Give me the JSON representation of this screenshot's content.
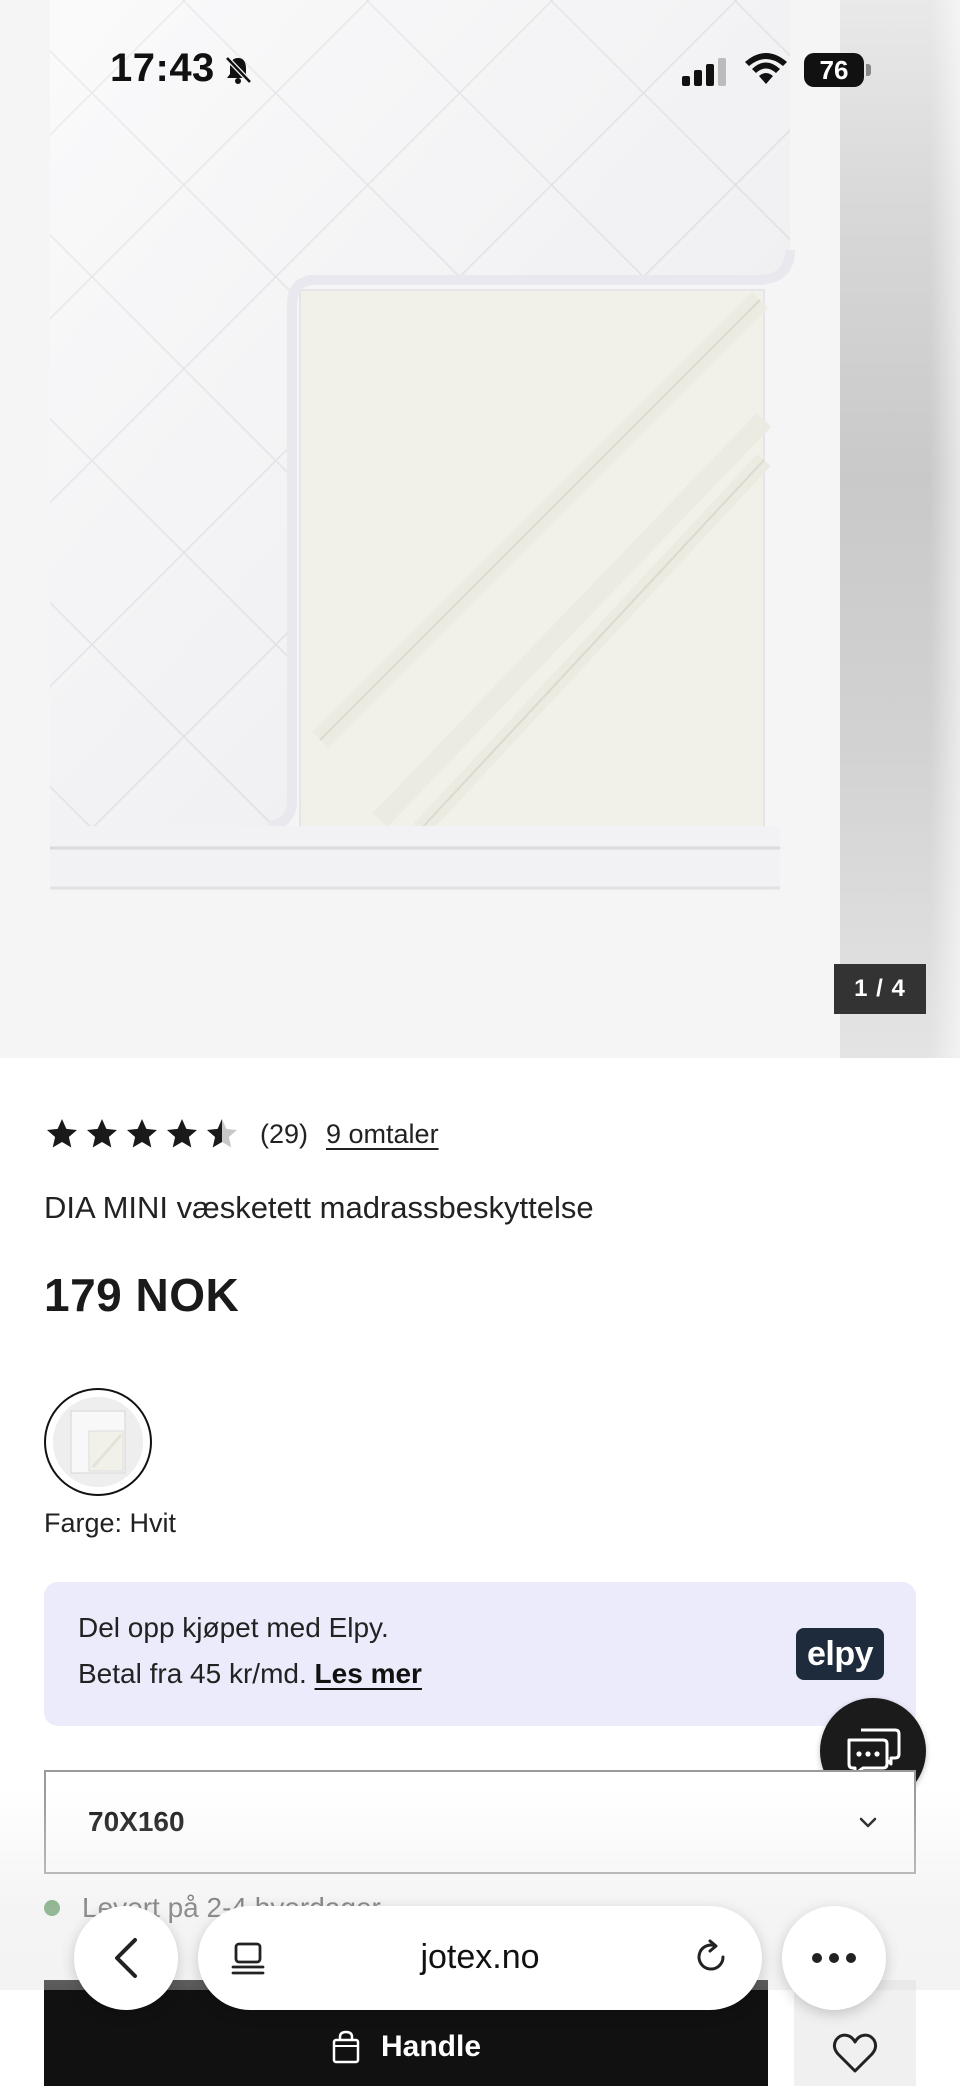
{
  "status_bar": {
    "time": "17:43",
    "battery": "76"
  },
  "gallery": {
    "counter": "1 / 4"
  },
  "product": {
    "rating": 4.5,
    "rating_count": "(29)",
    "reviews_link": "9 omtaler",
    "title": "DIA MINI væsketett madrassbeskyttelse",
    "price": "179 NOK",
    "color_label": "Farge: Hvit"
  },
  "elpy": {
    "line1": "Del opp kjøpet med Elpy.",
    "line2": "Betal fra 45 kr/md.",
    "link": "Les mer",
    "logo": "elpy"
  },
  "size": {
    "selected": "70X160"
  },
  "delivery": {
    "text": "Levert på 2-4 hverdager"
  },
  "buy": {
    "label": "Handle"
  },
  "browser": {
    "url": "jotex.no"
  },
  "colors": {
    "delivery_dot": "#2e7d32",
    "elpy_bg": "#ebebfb",
    "elpy_logo": "#1e2b3d",
    "buy_button": "#111111"
  }
}
